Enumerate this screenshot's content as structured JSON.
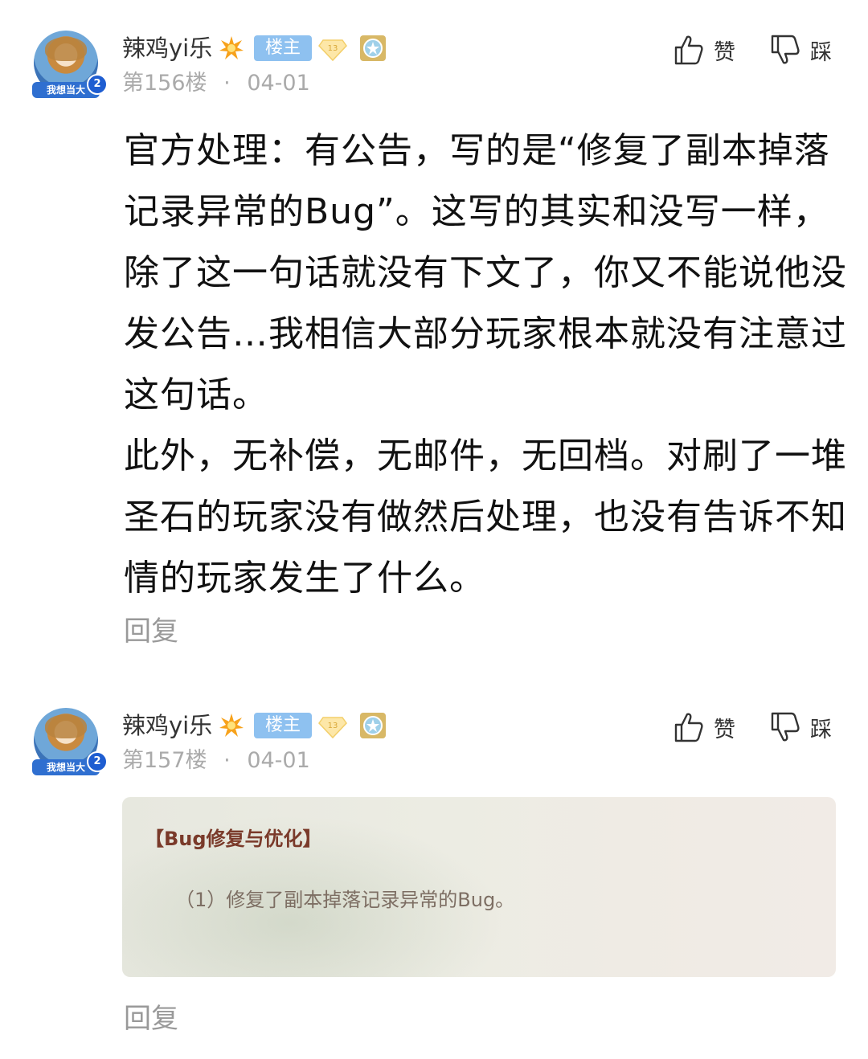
{
  "posts": [
    {
      "username": "辣鸡yi乐",
      "op_badge": "楼主",
      "level": "13",
      "avatar_text": "我想当大",
      "avatar_num": "2",
      "floor": "第156楼",
      "sep": "·",
      "date": "04-01",
      "like_label": "赞",
      "dislike_label": "踩",
      "paragraphs": [
        "官方处理：有公告，写的是“修复了副本掉落记录异常的Bug”。这写的其实和没写一样，除了这一句话就没有下文了，你又不能说他没发公告…我相信大部分玩家根本就没有注意过这句话。",
        "此外，无补偿，无邮件，无回档。对刷了一堆圣石的玩家没有做然后处理，也没有告诉不知情的玩家发生了什么。"
      ],
      "reply_label": "回复"
    },
    {
      "username": "辣鸡yi乐",
      "op_badge": "楼主",
      "level": "13",
      "avatar_text": "我想当大",
      "avatar_num": "2",
      "floor": "第157楼",
      "sep": "·",
      "date": "04-01",
      "like_label": "赞",
      "dislike_label": "踩",
      "image": {
        "heading": "【Bug修复与优化】",
        "line": "（1）修复了副本掉落记录异常的Bug。"
      },
      "reply_label": "回复"
    }
  ],
  "colors": {
    "op_badge_bg": "#8ec1f0",
    "meta_text": "#aaaaaa",
    "reply_text": "#999999"
  }
}
